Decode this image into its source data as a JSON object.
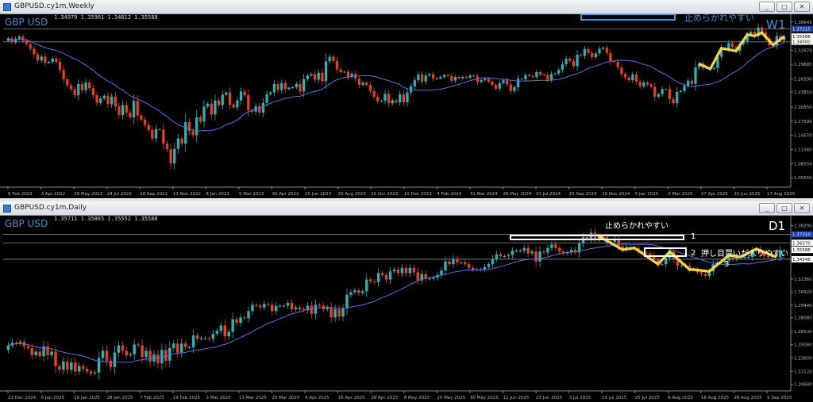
{
  "colors": {
    "background": "#000000",
    "bull": "#2bb3b3",
    "bear": "#e8401c",
    "ma": "#5a6fe0",
    "zigzag": "#ffd400",
    "zigzag_shadow": "#ffffff",
    "grid_text": "#b8b8b8",
    "label_blue": "#3d8fe0",
    "box_blue": "#3399dd",
    "box_white": "#ffffff",
    "hline": "#8a8a8a"
  },
  "weekly": {
    "window_title": "GBPUSD.cy1m,Weekly",
    "ohlc_text": "1.34979 1.35901 1.34812 1.35588",
    "symbol_label": "GBP USD",
    "timeframe_label": "W1",
    "annotation": "止めらかれやすい",
    "icon": "chart-window-icon"
  },
  "daily": {
    "window_title": "GBPUSD.cy1m,Daily",
    "ohlc_text": "1.35711 1.35865 1.35552 1.35588",
    "symbol_label": "GBP USD",
    "timeframe_label": "D1",
    "annotation_1": "止めらかれやすい",
    "annotation_2": "押し目買いが入りやすい",
    "marker_1": "1",
    "marker_2": "2",
    "marker_3": "3",
    "icon": "chart-window-icon"
  },
  "window_buttons": {
    "minimize": "_",
    "maximize": "□",
    "close": "✕"
  },
  "chart_data": [
    {
      "type": "candlestick",
      "title": "GBP USD",
      "timeframe": "W1",
      "x_ticks": [
        "6 Feb 2022",
        "3 Apr 2022",
        "29 May 2022",
        "24 Jul 2022",
        "18 Sep 2022",
        "13 Nov 2022",
        "8 Jan 2023",
        "5 Mar 2023",
        "30 Apr 2023",
        "25 Jun 2023",
        "20 Aug 2023",
        "15 Oct 2023",
        "10 Dec 2023",
        "4 Feb 2024",
        "31 Mar 2024",
        "26 May 2024",
        "21 Jul 2024",
        "15 Sep 2024",
        "10 Nov 2024",
        "5 Jan 2025",
        "2 Mar 2025",
        "27 Apr 2025",
        "22 Jun 2025",
        "17 Aug 2025"
      ],
      "y_ticks": [
        1.38645,
        1.3267,
        1.2968,
        1.2659,
        1.2381,
        1.2055,
        1.1759,
        1.1457,
        1.1156,
        1.0855,
        1.0555
      ],
      "ylim": [
        1.0355,
        1.3965
      ],
      "price_tags": [
        1.37215,
        1.35588,
        1.345
      ],
      "closes": [
        1.352,
        1.344,
        1.351,
        1.356,
        1.347,
        1.34,
        1.33,
        1.318,
        1.305,
        1.313,
        1.3,
        1.302,
        1.309,
        1.302,
        1.285,
        1.265,
        1.252,
        1.244,
        1.231,
        1.255,
        1.242,
        1.258,
        1.246,
        1.231,
        1.215,
        1.224,
        1.23,
        1.212,
        1.228,
        1.207,
        1.189,
        1.21,
        1.194,
        1.184,
        1.219,
        1.188,
        1.179,
        1.168,
        1.157,
        1.139,
        1.159,
        1.158,
        1.128,
        1.116,
        1.086,
        1.117,
        1.139,
        1.128,
        1.174,
        1.155,
        1.146,
        1.184,
        1.175,
        1.207,
        1.213,
        1.19,
        1.22,
        1.21,
        1.232,
        1.237,
        1.211,
        1.205,
        1.22,
        1.239,
        1.231,
        1.199,
        1.196,
        1.208,
        1.194,
        1.215,
        1.233,
        1.237,
        1.255,
        1.242,
        1.257,
        1.244,
        1.247,
        1.248,
        1.255,
        1.239,
        1.265,
        1.273,
        1.276,
        1.264,
        1.279,
        1.261,
        1.303,
        1.313,
        1.304,
        1.286,
        1.28,
        1.281,
        1.27,
        1.277,
        1.266,
        1.253,
        1.258,
        1.253,
        1.24,
        1.228,
        1.218,
        1.219,
        1.234,
        1.214,
        1.22,
        1.216,
        1.233,
        1.216,
        1.237,
        1.25,
        1.263,
        1.275,
        1.26,
        1.273,
        1.276,
        1.266,
        1.267,
        1.27,
        1.274,
        1.272,
        1.262,
        1.27,
        1.267,
        1.27,
        1.268,
        1.273,
        1.271,
        1.259,
        1.263,
        1.266,
        1.26,
        1.253,
        1.245,
        1.257,
        1.263,
        1.254,
        1.24,
        1.248,
        1.266,
        1.265,
        1.274,
        1.272,
        1.27,
        1.28,
        1.275,
        1.274,
        1.264,
        1.276,
        1.277,
        1.285,
        1.297,
        1.309,
        1.304,
        1.293,
        1.317,
        1.315,
        1.329,
        1.321,
        1.312,
        1.32,
        1.33,
        1.332,
        1.321,
        1.303,
        1.302,
        1.29,
        1.276,
        1.269,
        1.263,
        1.275,
        1.26,
        1.25,
        1.258,
        1.254,
        1.249,
        1.228,
        1.233,
        1.244,
        1.244,
        1.223,
        1.214,
        1.238,
        1.24,
        1.251,
        1.262,
        1.255,
        1.29,
        1.298,
        1.289,
        1.29,
        1.287,
        1.289,
        1.313,
        1.331,
        1.329,
        1.342,
        1.334,
        1.325,
        1.34,
        1.346,
        1.36,
        1.366,
        1.357,
        1.375,
        1.364,
        1.352,
        1.337,
        1.338,
        1.357,
        1.348,
        1.356
      ]
    },
    {
      "type": "candlestick",
      "title": "GBP USD",
      "timeframe": "D1",
      "x_ticks": [
        "23 Dec 2024",
        "6 Jan 2025",
        "16 Jan 2025",
        "28 Jan 2025",
        "7 Feb 2025",
        "19 Feb 2025",
        "3 Mar 2025",
        "13 Mar 2025",
        "25 Mar 2025",
        "4 Apr 2025",
        "16 Apr 2025",
        "28 Apr 2025",
        "8 May 2025",
        "20 May 2025",
        "30 May 2025",
        "11 Jun 2025",
        "23 Jun 2025",
        "3 Jul 2025",
        "15 Jul 2025",
        "25 Jul 2025",
        "6 Aug 2025",
        "18 Aug 2025",
        "28 Aug 2025",
        "9 Sep 2025"
      ],
      "y_ticks": [
        1.3829,
        1.3566,
        1.3236,
        1.3092,
        1.2944,
        1.2808,
        1.2653,
        1.2508,
        1.236,
        1.2212,
        1.2068
      ],
      "ylim": [
        1.1995,
        1.3903
      ],
      "price_tags": [
        1.3731,
        1.3637,
        1.35588,
        1.34548
      ],
      "closes": [
        1.25,
        1.253,
        1.252,
        1.254,
        1.249,
        1.247,
        1.239,
        1.243,
        1.238,
        1.249,
        1.239,
        1.243,
        1.227,
        1.223,
        1.232,
        1.223,
        1.231,
        1.221,
        1.227,
        1.224,
        1.221,
        1.219,
        1.22,
        1.236,
        1.244,
        1.233,
        1.226,
        1.242,
        1.25,
        1.244,
        1.239,
        1.24,
        1.251,
        1.25,
        1.237,
        1.244,
        1.232,
        1.24,
        1.23,
        1.245,
        1.233,
        1.247,
        1.252,
        1.242,
        1.252,
        1.248,
        1.248,
        1.261,
        1.257,
        1.258,
        1.258,
        1.257,
        1.263,
        1.266,
        1.272,
        1.26,
        1.265,
        1.279,
        1.275,
        1.281,
        1.28,
        1.288,
        1.295,
        1.294,
        1.292,
        1.296,
        1.295,
        1.288,
        1.294,
        1.294,
        1.294,
        1.297,
        1.29,
        1.292,
        1.29,
        1.289,
        1.294,
        1.285,
        1.295,
        1.294,
        1.29,
        1.292,
        1.281,
        1.29,
        1.282,
        1.291,
        1.306,
        1.309,
        1.311,
        1.308,
        1.31,
        1.323,
        1.321,
        1.32,
        1.33,
        1.328,
        1.323,
        1.332,
        1.334,
        1.33,
        1.336,
        1.33,
        1.336,
        1.331,
        1.322,
        1.329,
        1.324,
        1.324,
        1.325,
        1.328,
        1.333,
        1.343,
        1.34,
        1.346,
        1.342,
        1.342,
        1.34,
        1.336,
        1.334,
        1.334,
        1.334,
        1.337,
        1.34,
        1.346,
        1.351,
        1.349,
        1.349,
        1.35,
        1.355,
        1.355,
        1.355,
        1.358,
        1.352,
        1.354,
        1.343,
        1.354,
        1.353,
        1.358,
        1.362,
        1.358,
        1.354,
        1.352,
        1.353,
        1.356,
        1.353,
        1.363,
        1.37,
        1.368,
        1.375,
        1.368,
        1.371,
        1.37,
        1.364,
        1.365,
        1.368,
        1.36,
        1.356,
        1.359,
        1.357,
        1.358,
        1.354,
        1.353,
        1.352,
        1.35,
        1.346,
        1.34,
        1.34,
        1.347,
        1.354,
        1.346,
        1.338,
        1.339,
        1.338,
        1.334,
        1.334,
        1.331,
        1.329,
        1.327,
        1.332,
        1.34,
        1.342,
        1.342,
        1.344,
        1.35,
        1.346,
        1.349,
        1.348,
        1.348,
        1.348,
        1.355,
        1.357,
        1.352,
        1.349,
        1.348,
        1.351,
        1.348,
        1.355,
        1.355
      ]
    }
  ]
}
